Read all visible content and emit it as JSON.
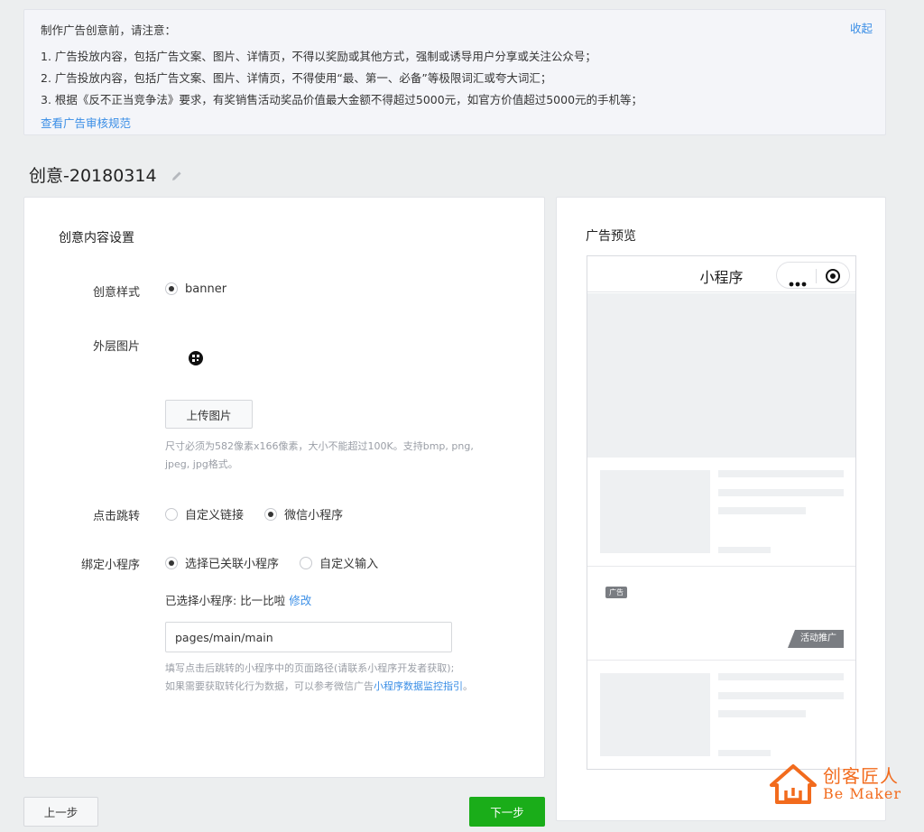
{
  "notice": {
    "title": "制作广告创意前，请注意：",
    "collapse": "收起",
    "lines": [
      "1. 广告投放内容，包括广告文案、图片、详情页，不得以奖励或其他方式，强制或诱导用户分享或关注公众号；",
      "2. 广告投放内容，包括广告文案、图片、详情页，不得使用“最、第一、必备”等极限词汇或夸大词汇；",
      "3. 根据《反不正当竞争法》要求，有奖销售活动奖品价值最大金额不得超过5000元，如官方价值超过5000元的手机等；"
    ],
    "rules_link": "查看广告审核规范"
  },
  "creative": {
    "name": "创意-20180314"
  },
  "form": {
    "section_title": "创意内容设置",
    "style": {
      "label": "创意样式",
      "option": "banner"
    },
    "image": {
      "label": "外层图片",
      "upload_button": "上传图片",
      "hint_line1": "尺寸必须为582像素x166像素，大小不能超过100K。支持bmp, png,",
      "hint_line2": "jpeg, jpg格式。"
    },
    "jump": {
      "label": "点击跳转",
      "option1": "自定义链接",
      "option2": "微信小程序"
    },
    "bind": {
      "label": "绑定小程序",
      "option1": "选择已关联小程序",
      "option2": "自定义输入",
      "selected_text": "已选择小程序: 比一比啦",
      "modify_link": "修改",
      "path_value": "pages/main/main",
      "hint_line1": "填写点击后跳转的小程序中的页面路径(请联系小程序开发者获取);",
      "hint_line2_prefix": "如果需要获取转化行为数据，可以参考微信广告",
      "hint_line2_link": "小程序数据监控指引",
      "hint_line2_suffix": "。"
    }
  },
  "buttons": {
    "prev": "上一步",
    "next": "下一步"
  },
  "preview": {
    "title": "广告预览",
    "phone_title": "小程序",
    "ad_tag": "广告",
    "promo_tag": "活动推广"
  },
  "watermark": {
    "cn": "创客匠人",
    "en": "Be Maker"
  },
  "colors": {
    "accent": "#1aad19",
    "link": "#3a8ee6",
    "brand_orange": "#f26b1d"
  }
}
